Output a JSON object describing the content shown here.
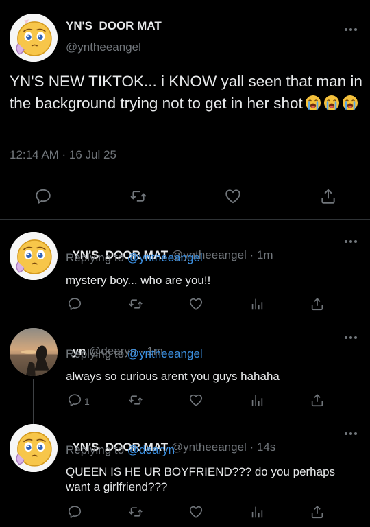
{
  "main_tweet": {
    "display_name": "YN'S  DOOR MAT",
    "handle": "@yntheeangel",
    "text": "YN'S NEW TIKTOK... i KNOW yall seen that man in the background trying not to get in her shot",
    "emojis": [
      "loudly-crying-face",
      "loudly-crying-face",
      "loudly-crying-face"
    ],
    "timestamp": "12:14 AM · 16 Jul 25"
  },
  "replies": [
    {
      "display_name": "YN'S  DOOR MAT",
      "handle_time": "@yntheeangel · 1m",
      "replying_prefix": "Replying to",
      "replying_to": "@yntheeangel",
      "text": "mystery boy... who are you!!",
      "reply_count": ""
    },
    {
      "display_name": "yn",
      "handle_time": "@dearyn · 1m",
      "replying_prefix": "Replying to",
      "replying_to": "@yntheeangel",
      "text": "always so curious arent you guys hahaha",
      "reply_count": "1"
    },
    {
      "display_name": "YN'S  DOOR MAT",
      "handle_time": "@yntheeangel · 14s",
      "replying_prefix": "Replying to",
      "replying_to": "@dearyn",
      "text": "QUEEN IS HE UR BOYFRIEND??? do you perhaps want a girlfriend???",
      "reply_count": ""
    }
  ],
  "colors": {
    "background": "#000000",
    "text": "#e7e9ea",
    "secondary": "#71767b",
    "link": "#3b8fe0",
    "divider": "#2f3336"
  }
}
